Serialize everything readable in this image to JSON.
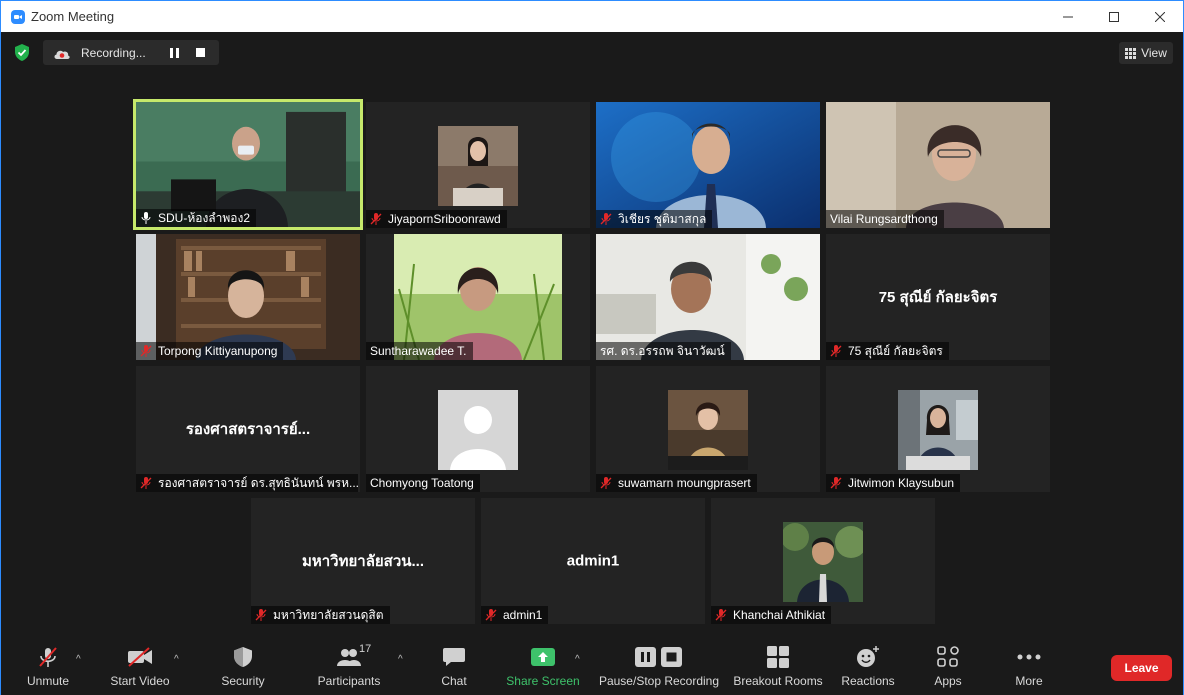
{
  "window": {
    "title": "Zoom Meeting"
  },
  "recording": {
    "label": "Recording..."
  },
  "view_button": {
    "label": "View"
  },
  "tiles": [
    {
      "name": "SDU-ห้องลำพอง2",
      "muted": false
    },
    {
      "name": "JiyapornSriboonrawd",
      "muted": true
    },
    {
      "name": "วิเชียร ชุติมาสกุล",
      "muted": true
    },
    {
      "name": "Vilai Rungsardthong",
      "muted": false
    },
    {
      "name": "Torpong Kittiyanupong",
      "muted": true
    },
    {
      "name": "Suntharawadee T.",
      "muted": false
    },
    {
      "name": "รศ. ดร.อรรถพ จินาวัฒน์",
      "muted": false
    },
    {
      "name": "75 สุณีย์ กัลยะจิตร",
      "muted": true,
      "big": "75 สุณีย์ กัลยะจิตร"
    },
    {
      "name": "รองศาสตราจารย์ ดร.สุทธินันทน์ พรห...",
      "muted": true,
      "big": "รองศาสตราจารย์..."
    },
    {
      "name": "Chomyong Toatong",
      "muted": false
    },
    {
      "name": "suwamarn moungprasert",
      "muted": true
    },
    {
      "name": "Jitwimon Klaysubun",
      "muted": true
    },
    {
      "name": "มหาวิทยาลัยสวนดุสิต",
      "muted": true,
      "big": "มหาวิทยาลัยสวน..."
    },
    {
      "name": "admin1",
      "muted": true,
      "big": "admin1"
    },
    {
      "name": "Khanchai Athikiat",
      "muted": true
    }
  ],
  "toolbar": {
    "unmute": "Unmute",
    "start_video": "Start Video",
    "security": "Security",
    "participants": "Participants",
    "participants_count": "17",
    "chat": "Chat",
    "share_screen": "Share Screen",
    "pause_stop_recording": "Pause/Stop Recording",
    "breakout_rooms": "Breakout Rooms",
    "reactions": "Reactions",
    "apps": "Apps",
    "more": "More",
    "leave": "Leave"
  },
  "colors": {
    "active_speaker_border": "#c6e96b",
    "leave_button": "#e02828",
    "share_screen_green": "#3ec26b",
    "mic_muted_red": "#e02828",
    "zoom_blue": "#2d8cff"
  }
}
